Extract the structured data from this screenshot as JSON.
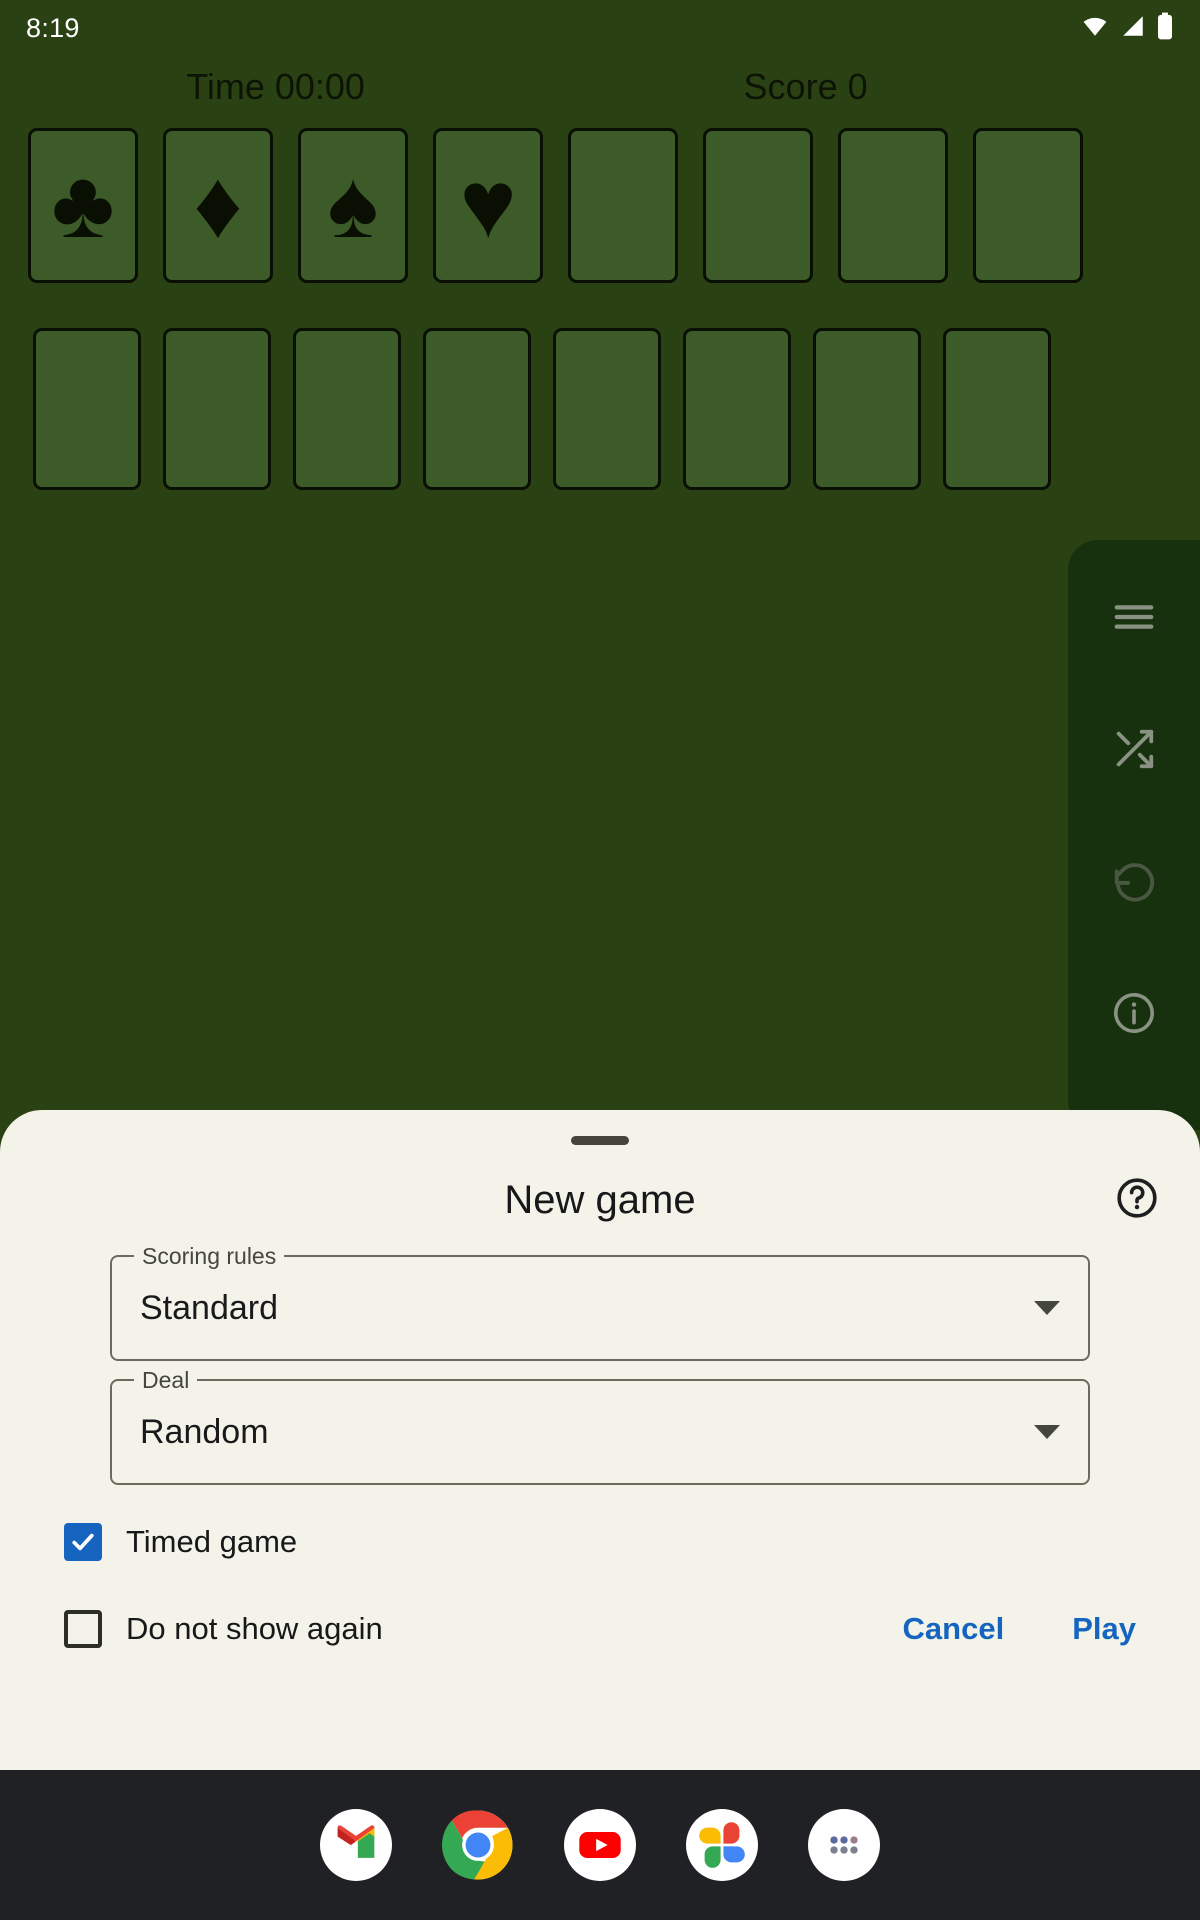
{
  "status_bar": {
    "clock": "8:19",
    "icons": [
      "wifi-icon",
      "cell-signal-icon",
      "battery-icon"
    ]
  },
  "game": {
    "time_label": "Time 00:00",
    "score_label": "Score 0",
    "background_color": "#2a4213",
    "card_slot_color": "#3d5a29",
    "foundations": [
      {
        "suit": "clubs",
        "glyph": "♣",
        "filled": true
      },
      {
        "suit": "diamonds",
        "glyph": "♦",
        "filled": true
      },
      {
        "suit": "spades",
        "glyph": "♠",
        "filled": true
      },
      {
        "suit": "hearts",
        "glyph": "♥",
        "filled": true
      },
      {
        "suit": "empty-5",
        "glyph": "",
        "filled": false
      },
      {
        "suit": "empty-6",
        "glyph": "",
        "filled": false
      },
      {
        "suit": "empty-7",
        "glyph": "",
        "filled": false
      },
      {
        "suit": "empty-8",
        "glyph": "",
        "filled": false
      }
    ],
    "tableau_slots": 8
  },
  "toolbar": {
    "background_color": "#17300d",
    "items": [
      {
        "name": "menu-icon",
        "enabled": true
      },
      {
        "name": "shuffle-icon",
        "enabled": true
      },
      {
        "name": "undo-icon",
        "enabled": false
      },
      {
        "name": "info-icon",
        "enabled": true
      }
    ]
  },
  "sheet": {
    "title": "New game",
    "help_icon": "help-circle-icon",
    "background_color": "#f4f3e9",
    "fields": [
      {
        "label": "Scoring rules",
        "value": "Standard"
      },
      {
        "label": "Deal",
        "value": "Random"
      }
    ],
    "checkboxes": [
      {
        "label": "Timed game",
        "checked": true
      },
      {
        "label": "Do not show again",
        "checked": false
      }
    ],
    "cancel_label": "Cancel",
    "play_label": "Play",
    "accent_color": "#1565c0"
  },
  "nav_bar": {
    "background_color": "#202124",
    "apps": [
      "gmail-icon",
      "chrome-icon",
      "youtube-icon",
      "google-photos-icon",
      "app-drawer-icon"
    ]
  }
}
